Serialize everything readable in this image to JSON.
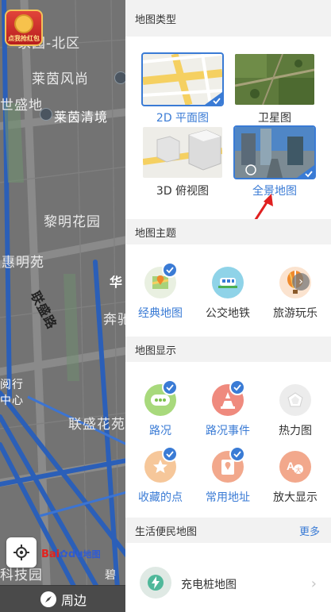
{
  "map": {
    "labels": [
      "家园-北区",
      "莱茵风尚",
      "世盛地",
      "莱茵清境",
      "黎明花园",
      "惠明苑",
      "联盛路",
      "华",
      "奔驰",
      "阅行",
      "中心",
      "联盛花苑",
      "科技园",
      "碧"
    ],
    "redbag_text": "点我抢红包",
    "baidu_logo": {
      "bai": "Bai",
      "du": "du",
      "ditu": "地图"
    },
    "nearby": "周边"
  },
  "panel": {
    "map_type": {
      "header": "地图类型",
      "items": [
        {
          "label": "2D 平面图",
          "selected": true
        },
        {
          "label": "卫星图",
          "selected": false
        },
        {
          "label": "3D 俯视图",
          "selected": false
        },
        {
          "label": "全景地图",
          "selected": true
        }
      ]
    },
    "map_theme": {
      "header": "地图主题",
      "items": [
        {
          "label": "经典地图",
          "selected": true
        },
        {
          "label": "公交地铁",
          "selected": false
        },
        {
          "label": "旅游玩乐",
          "selected": false
        }
      ]
    },
    "map_display": {
      "header": "地图显示",
      "items": [
        {
          "label": "路况",
          "selected": true
        },
        {
          "label": "路况事件",
          "selected": true
        },
        {
          "label": "热力图",
          "selected": false
        },
        {
          "label": "收藏的点",
          "selected": true
        },
        {
          "label": "常用地址",
          "selected": true
        },
        {
          "label": "放大显示",
          "selected": false
        }
      ]
    },
    "life_map": {
      "header": "生活便民地图",
      "more": "更多",
      "items": [
        {
          "label": "充电桩地图"
        }
      ]
    }
  },
  "colors": {
    "accent": "#3a7bd5",
    "map_bg": "#737373",
    "road_blue": "#2b5fb8",
    "arrow_red": "#e02020"
  },
  "icons": {
    "traffic": "traffic-icon",
    "traffic_event": "traffic-cone-icon",
    "heatmap": "heatmap-icon",
    "favorites": "star-icon",
    "common_address": "address-pin-icon",
    "magnify": "text-zoom-icon",
    "classic_map": "map-pin-icon",
    "transit": "train-icon",
    "tourism": "hot-air-balloon-icon",
    "charging": "charging-bolt-icon"
  }
}
